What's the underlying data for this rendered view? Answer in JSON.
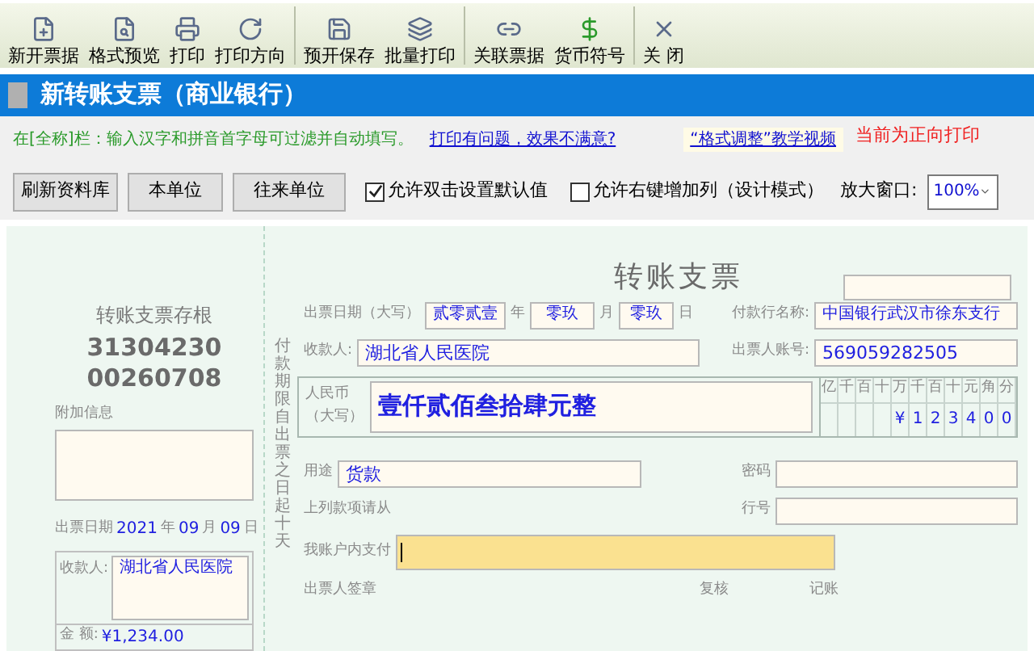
{
  "toolbar": [
    {
      "label": "新开票据"
    },
    {
      "label": "格式预览"
    },
    {
      "label": "打印"
    },
    {
      "label": "打印方向"
    },
    {
      "label": "预开保存"
    },
    {
      "label": "批量打印"
    },
    {
      "label": "关联票据"
    },
    {
      "label": "货币符号"
    },
    {
      "label": "关 闭"
    }
  ],
  "window": {
    "title": "新转账支票（商业银行）"
  },
  "info": {
    "hint": "在[全称]栏：输入汉字和拼音首字母可过滤并自动填写。",
    "help_link": "打印有问题，效果不满意?",
    "video_link": "“格式调整”教学视频",
    "print_direction": "当前为正向打印"
  },
  "buttons": [
    "刷新资料库",
    "本单位",
    "往来单位"
  ],
  "options": [
    {
      "label": "允许双击设置默认值",
      "checked": true
    },
    {
      "label": "允许右键增加列（设计模式）",
      "checked": false
    }
  ],
  "zoom": {
    "label": "放大窗口:",
    "value": "100%"
  },
  "stub": {
    "title": "转账支票存根",
    "number_1": "31304230",
    "number_2": "00260708",
    "extra_label": "附加信息",
    "date_label": "出票日期",
    "year": "2021",
    "year_unit": "年",
    "month": "09",
    "month_unit": "月",
    "day": "09",
    "day_unit": "日",
    "payee_label": "收款人:",
    "payee": "湖北省人民医院",
    "amount_label": "金 额:",
    "amount": "¥1,234.00"
  },
  "cheque": {
    "title": "转账支票",
    "validity": "付款期限自出票之日起十天",
    "date_label": "出票日期（大写）",
    "year": "贰零贰壹",
    "year_unit": "年",
    "month": "零玖",
    "month_unit": "月",
    "day": "零玖",
    "day_unit": "日",
    "bank_label": "付款行名称:",
    "bank": "中国银行武汉市徐东支行",
    "payee_label": "收款人:",
    "payee": "湖北省人民医院",
    "account_label": "出票人账号:",
    "account": "569059282505",
    "currency_label_1": "人民币",
    "currency_label_2": "（大写）",
    "amount_words": "壹仟贰佰叁拾肆元整",
    "digit_headers": [
      "亿",
      "千",
      "百",
      "十",
      "万",
      "千",
      "百",
      "十",
      "元",
      "角",
      "分"
    ],
    "digits": [
      "¥",
      "1",
      "2",
      "3",
      "4",
      "0",
      "0"
    ],
    "purpose_label": "用途",
    "purpose": "货款",
    "password_label": "密码",
    "bank_no_label": "行号",
    "instruction_label_1": "上列款项请从",
    "instruction_label_2": "我账户内支付",
    "drawer_label": "出票人签章",
    "check_label": "复核",
    "book_label": "记账"
  }
}
